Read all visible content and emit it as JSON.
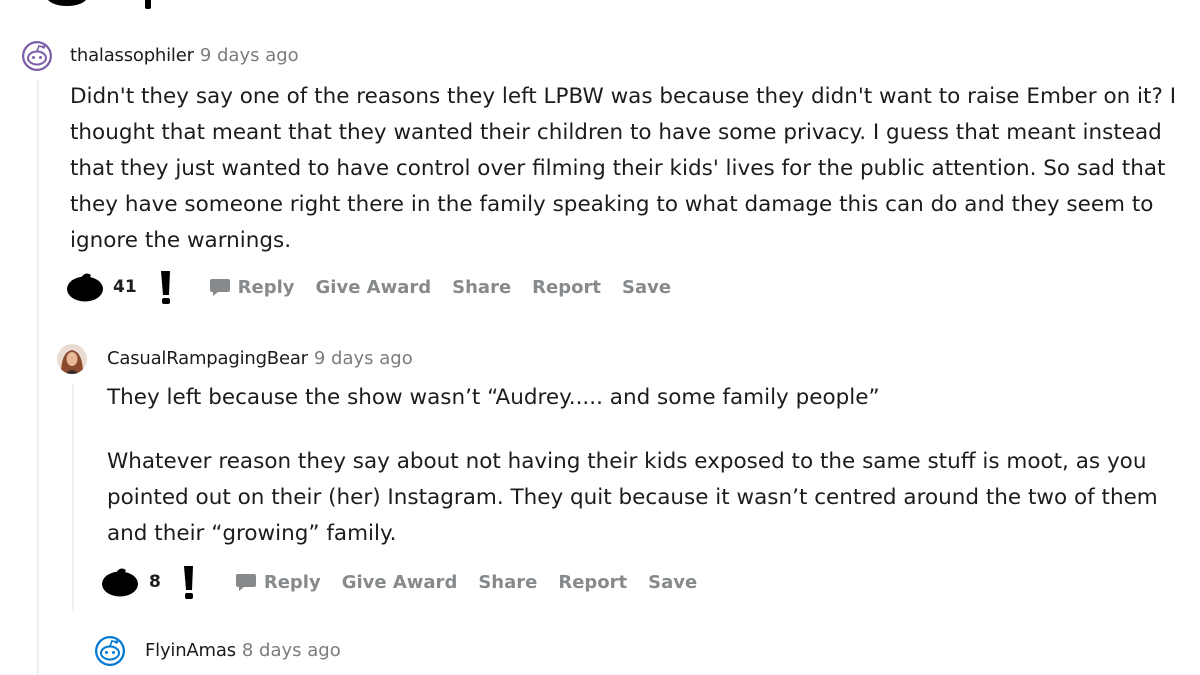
{
  "comments": [
    {
      "username": "thalassophiler",
      "time": "9 days ago",
      "avatar": "snoo-avatar-purple",
      "paragraphs": [
        "Didn't they say one of the reasons they left LPBW was because they didn't want to raise Ember on it? I thought that meant that they wanted their children to have some privacy. I guess that meant instead that they just wanted to have control over filming their kids' lives for the public attention. So sad that they have someone right there in the family speaking to what damage this can do and they seem to ignore the warnings."
      ],
      "score": "41",
      "actions": {
        "reply": "Reply",
        "award": "Give Award",
        "share": "Share",
        "report": "Report",
        "save": "Save"
      }
    },
    {
      "username": "CasualRampagingBear",
      "time": "9 days ago",
      "avatar": "photo-avatar",
      "paragraphs": [
        "They left because the show wasn’t “Audrey..... and some family people”",
        "Whatever reason they say about not having their kids exposed to the same stuff is moot, as you pointed out on their (her) Instagram. They quit because it wasn’t centred around the two of them and their “growing” family."
      ],
      "score": "8",
      "actions": {
        "reply": "Reply",
        "award": "Give Award",
        "share": "Share",
        "report": "Report",
        "save": "Save"
      }
    },
    {
      "username": "FlyinAmas",
      "time": "8 days ago",
      "avatar": "snoo-avatar-blue"
    }
  ],
  "colors": {
    "action_gray": "#878a8c",
    "meta_gray": "#7c7c7c",
    "text": "#1c1c1c",
    "thread_line": "#edeff1",
    "snoo_purple": "#7b5ea7",
    "snoo_blue": "#0079d3"
  }
}
